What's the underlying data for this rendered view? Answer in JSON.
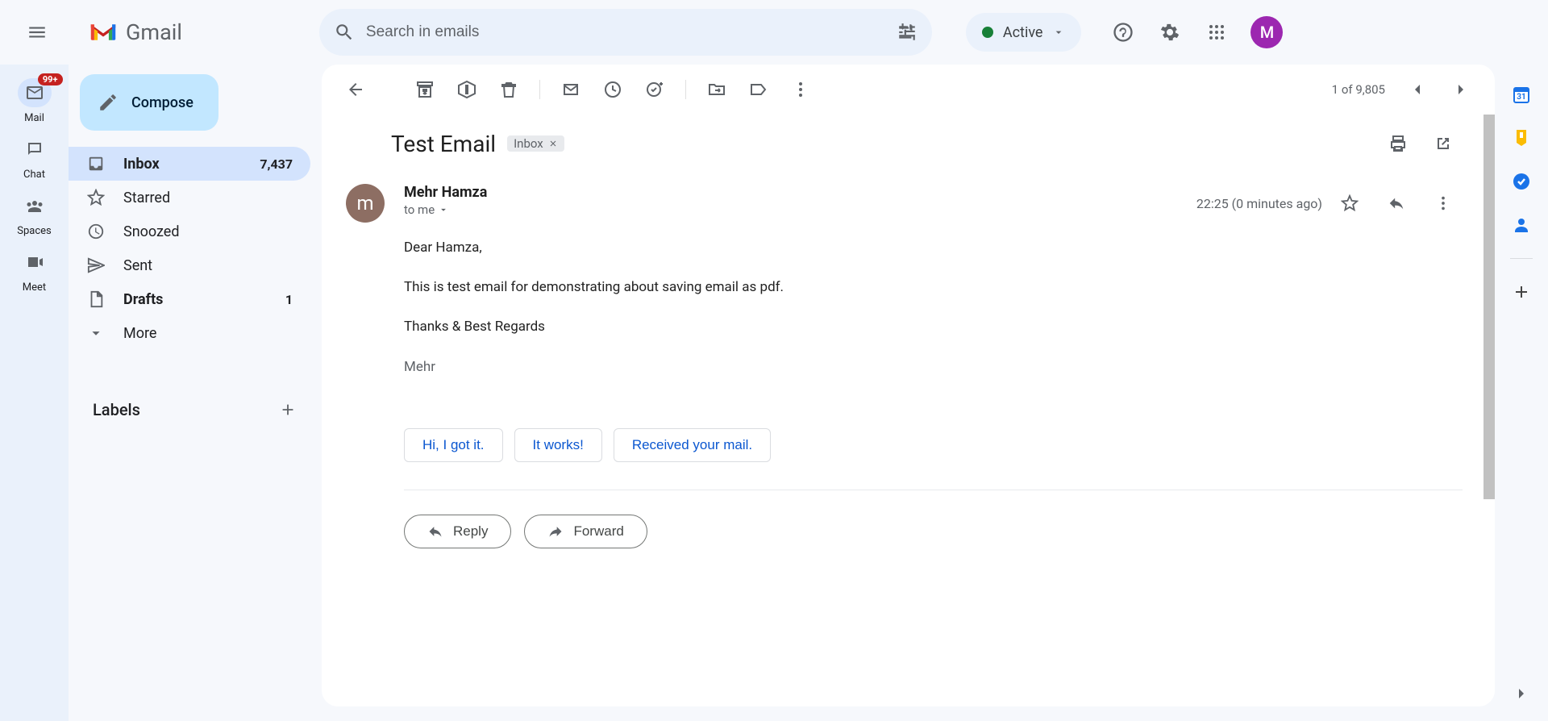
{
  "app": {
    "name": "Gmail"
  },
  "search": {
    "placeholder": "Search in emails"
  },
  "status": {
    "label": "Active"
  },
  "profile": {
    "initial": "M"
  },
  "rail": {
    "mail": {
      "label": "Mail",
      "badge": "99+"
    },
    "chat": {
      "label": "Chat"
    },
    "spaces": {
      "label": "Spaces"
    },
    "meet": {
      "label": "Meet"
    }
  },
  "compose": {
    "label": "Compose"
  },
  "folders": {
    "inbox": {
      "label": "Inbox",
      "count": "7,437"
    },
    "starred": {
      "label": "Starred"
    },
    "snoozed": {
      "label": "Snoozed"
    },
    "sent": {
      "label": "Sent"
    },
    "drafts": {
      "label": "Drafts",
      "count": "1"
    },
    "more": {
      "label": "More"
    }
  },
  "labelsHeader": "Labels",
  "pager": {
    "text": "1 of 9,805"
  },
  "subject": "Test Email",
  "subjectLabel": "Inbox",
  "sender": {
    "name": "Mehr Hamza",
    "initial": "m",
    "to": "to me",
    "time": "22:25 (0 minutes ago)"
  },
  "body": {
    "p1": "Dear Hamza,",
    "p2": "This is test email for demonstrating about saving email as pdf.",
    "p3": "Thanks & Best Regards",
    "sig": "Mehr"
  },
  "smartReplies": {
    "r1": "Hi, I got it.",
    "r2": "It works!",
    "r3": "Received your mail."
  },
  "actions": {
    "reply": "Reply",
    "forward": "Forward"
  }
}
